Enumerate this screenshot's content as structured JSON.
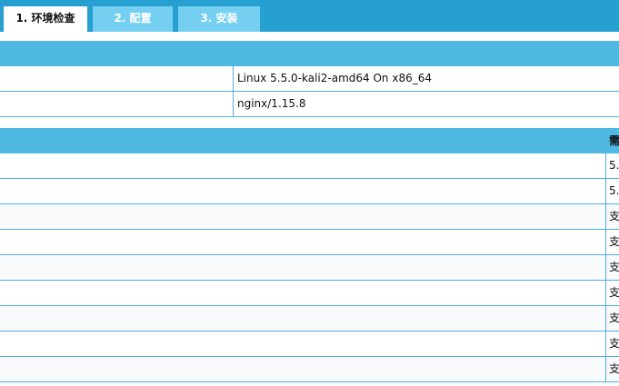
{
  "tabs": [
    {
      "label": "1. 环境检查",
      "active": true
    },
    {
      "label": "2. 配置",
      "active": false
    },
    {
      "label": "3. 安装",
      "active": false
    }
  ],
  "server_info": {
    "rows": [
      {
        "value": "Linux 5.5.0-kali2-amd64 On x86_64"
      },
      {
        "value": "nginx/1.15.8"
      }
    ]
  },
  "requirements": {
    "header_label": "需",
    "rows": [
      {
        "value": "5."
      },
      {
        "value": "5."
      },
      {
        "value": "支"
      },
      {
        "value": "支"
      },
      {
        "value": "支"
      },
      {
        "value": "支"
      },
      {
        "value": "支"
      },
      {
        "value": "支"
      },
      {
        "value": "支"
      }
    ]
  },
  "colors": {
    "topbar": "#269fd1",
    "tab_inactive": "#75cff0",
    "section_header": "#4fb9e2",
    "row_border": "#4fb0d6"
  }
}
